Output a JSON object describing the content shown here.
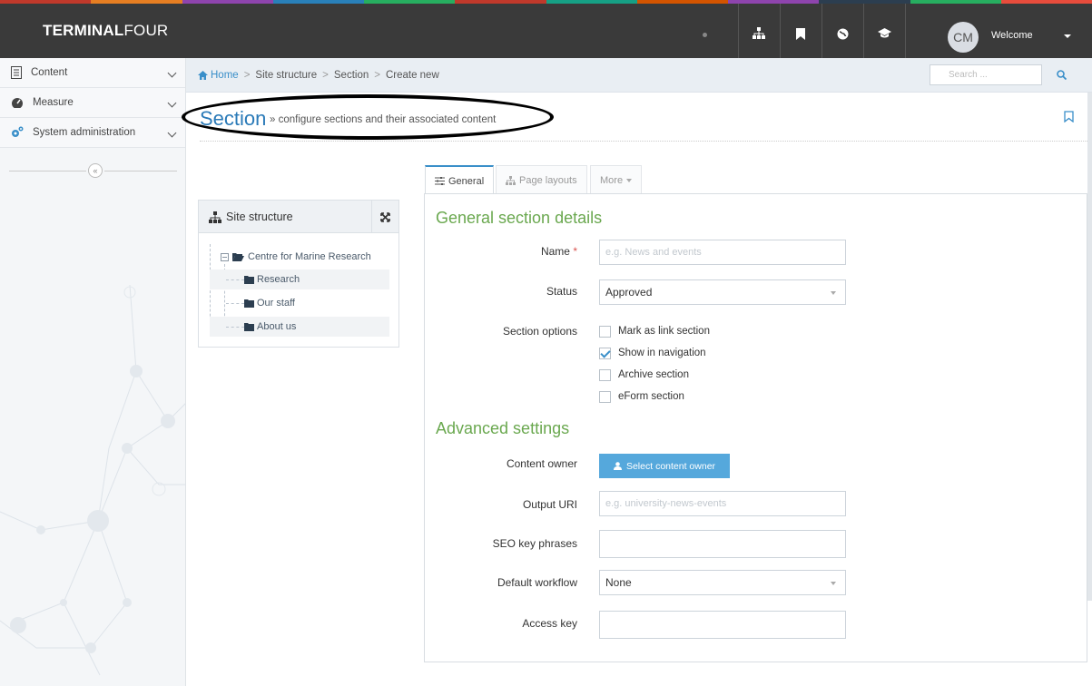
{
  "app": {
    "brand_bold": "TERMINAL",
    "brand_light": "FOUR"
  },
  "topbar": {
    "icons": [
      "sitemap-icon",
      "bookmark-icon",
      "globe-icon",
      "graduation-cap-icon"
    ],
    "avatar_initials": "CM",
    "welcome_label": "Welcome",
    "stripe_colors": [
      "#c0392b",
      "#e67e22",
      "#8e44ad",
      "#2980b9",
      "#27ae60",
      "#c0392b",
      "#16a085",
      "#d35400",
      "#8e44ad",
      "#2c3e50",
      "#27ae60",
      "#e74c3c"
    ]
  },
  "sidebar": {
    "items": [
      {
        "label": "Content",
        "icon": "document-icon"
      },
      {
        "label": "Measure",
        "icon": "dashboard-icon"
      },
      {
        "label": "System administration",
        "icon": "gears-icon"
      }
    ],
    "collapse_glyph": "«"
  },
  "breadcrumb": {
    "items": [
      "Home",
      "Site structure",
      "Section",
      "Create new"
    ],
    "separator": ">",
    "search_placeholder": "Search ..."
  },
  "page": {
    "title": "Section",
    "subtitle": "» configure sections and their associated content"
  },
  "tree": {
    "title": "Site structure",
    "root": "Centre for Marine Research",
    "children": [
      "Research",
      "Our staff",
      "About us"
    ]
  },
  "tabs": [
    {
      "label": "General",
      "active": true
    },
    {
      "label": "Page layouts",
      "active": false
    },
    {
      "label": "More",
      "active": false
    }
  ],
  "form": {
    "general_title": "General section details",
    "name_label": "Name",
    "required_mark": "*",
    "name_placeholder": "e.g. News and events",
    "status_label": "Status",
    "status_value": "Approved",
    "options_label": "Section options",
    "options": [
      {
        "label": "Mark as link section",
        "checked": false
      },
      {
        "label": "Show in navigation",
        "checked": true
      },
      {
        "label": "Archive section",
        "checked": false
      },
      {
        "label": "eForm section",
        "checked": false
      }
    ],
    "advanced_title": "Advanced settings",
    "owner_label": "Content owner",
    "owner_button": "Select content owner",
    "uri_label": "Output URI",
    "uri_placeholder": "e.g. university-news-events",
    "seo_label": "SEO key phrases",
    "workflow_label": "Default workflow",
    "workflow_value": "None",
    "access_label": "Access key"
  }
}
